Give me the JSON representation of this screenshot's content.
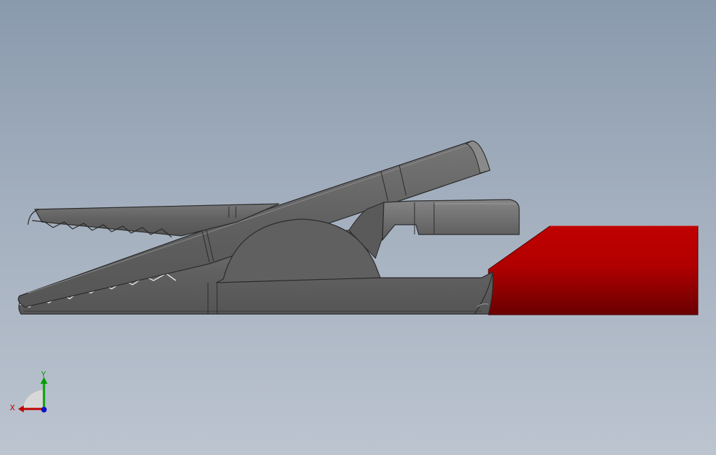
{
  "viewport": {
    "background_top": "#8a9aad",
    "background_bottom": "#bcc4d0"
  },
  "model": {
    "metal_color": "#5e5e5e",
    "metal_highlight": "#7a7a7a",
    "metal_edge": "#2a2a2a",
    "insulator_color": "#b80000",
    "insulator_dark": "#7a0000"
  },
  "triad": {
    "x_label": "X",
    "y_label": "Y",
    "x_color": "#c00000",
    "y_color": "#00a000",
    "z_color": "#0000c0"
  }
}
